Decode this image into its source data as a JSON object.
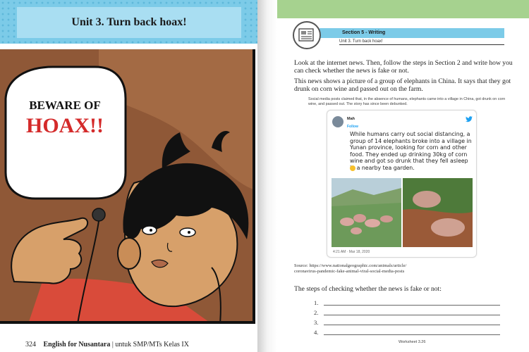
{
  "left_page": {
    "unit_title": "Unit 3. Turn back hoax!",
    "speech_line1": "BEWARE OF",
    "speech_line2": "HOAX!!",
    "footer_page_number": "324",
    "footer_book": "English for Nusantara",
    "footer_edition": "untuk SMP/MTs Kelas IX"
  },
  "right_page": {
    "section_label": "Section 5 - Writing",
    "section_sub": "Unit 3. Turn back hoax!",
    "instruction": "Look at the internet news. Then, follow the steps in Section 2 and write how you can check whether the news is fake or not.",
    "summary": "This news shows a picture of a group of elephants in China. It says that they got drunk on corn wine and passed out on the farm.",
    "caption": "Social media posts claimed that, in the absence of humans, elephants came into a village in China, got drunk on corn wine, and passed out. The story has since been debunked.",
    "tweet": {
      "handle": "Mah",
      "follow": "Follow",
      "text": "While humans carry out social distancing, a group of 14 elephants broke into a village in Yunan province, looking for corn and other food. They ended up drinking 30kg of corn wine and got so drunk that they fell asleep in a nearby tea garden.",
      "timestamp": "4:21 AM · Mar 18, 2020"
    },
    "source_line1": "Source: https://www.nationalgeographic.com/animals/article/",
    "source_line2": "coronavirus-pandemic-fake-animal-viral-social-media-posts",
    "steps_title": "The steps of checking whether the news is fake or not:",
    "steps": [
      "1.",
      "2.",
      "3.",
      "4."
    ],
    "worksheet": "Worksheet 3.26"
  },
  "colors": {
    "banner_blue": "#7ccbe8",
    "green_band": "#a6d28f",
    "hoax_red": "#d42a2a"
  }
}
